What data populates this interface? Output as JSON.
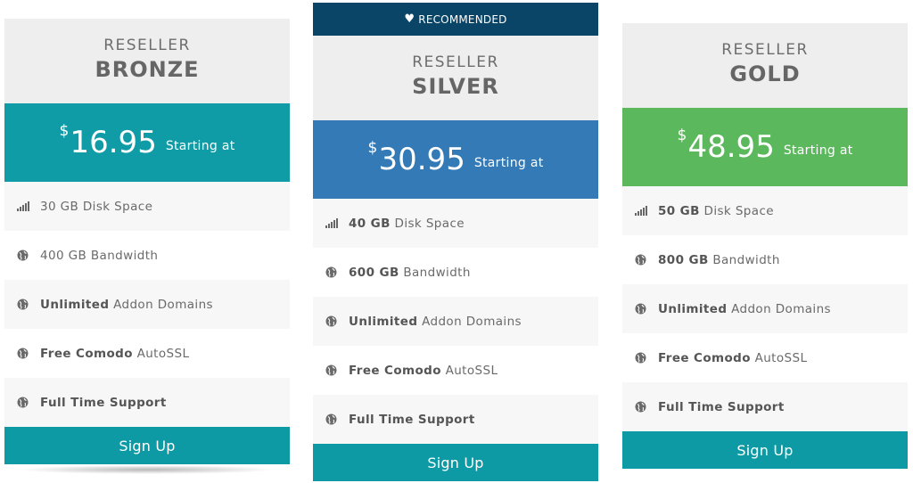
{
  "colors": {
    "bronze_price_bg": "#0f9ca7",
    "silver_price_bg": "#337ab7",
    "gold_price_bg": "#5cb85c",
    "ribbon_bg": "#0a4466",
    "signup_bg": "#0e9aa4"
  },
  "ribbon": {
    "icon": "heart-icon",
    "label": "RECOMMENDED"
  },
  "plans": {
    "bronze": {
      "tier": "RESELLER",
      "name": "BRONZE",
      "currency": "$",
      "price": "16.95",
      "starting": "Starting at",
      "features": [
        {
          "icon": "signal-bars-icon",
          "bold": "",
          "text": "30 GB Disk Space"
        },
        {
          "icon": "globe-icon",
          "bold": "",
          "text": "400 GB Bandwidth"
        },
        {
          "icon": "globe-icon",
          "bold": "Unlimited",
          "text": " Addon Domains"
        },
        {
          "icon": "globe-icon",
          "bold": "Free Comodo",
          "text": " AutoSSL"
        },
        {
          "icon": "globe-icon",
          "bold": "Full Time Support",
          "text": ""
        }
      ],
      "signup": "Sign Up"
    },
    "silver": {
      "tier": "RESELLER",
      "name": "SILVER",
      "currency": "$",
      "price": "30.95",
      "starting": "Starting at",
      "features": [
        {
          "icon": "signal-bars-icon",
          "bold": "40 GB",
          "text": " Disk Space"
        },
        {
          "icon": "globe-icon",
          "bold": "600 GB",
          "text": " Bandwidth"
        },
        {
          "icon": "globe-icon",
          "bold": "Unlimited",
          "text": " Addon Domains"
        },
        {
          "icon": "globe-icon",
          "bold": "Free Comodo",
          "text": " AutoSSL"
        },
        {
          "icon": "globe-icon",
          "bold": "Full Time Support",
          "text": ""
        }
      ],
      "signup": "Sign Up"
    },
    "gold": {
      "tier": "RESELLER",
      "name": "GOLD",
      "currency": "$",
      "price": "48.95",
      "starting": "Starting at",
      "features": [
        {
          "icon": "signal-bars-icon",
          "bold": "50 GB",
          "text": " Disk Space"
        },
        {
          "icon": "globe-icon",
          "bold": "800 GB",
          "text": " Bandwidth"
        },
        {
          "icon": "globe-icon",
          "bold": "Unlimited",
          "text": " Addon Domains"
        },
        {
          "icon": "globe-icon",
          "bold": "Free Comodo",
          "text": " AutoSSL"
        },
        {
          "icon": "globe-icon",
          "bold": "Full Time Support",
          "text": ""
        }
      ],
      "signup": "Sign Up"
    }
  }
}
